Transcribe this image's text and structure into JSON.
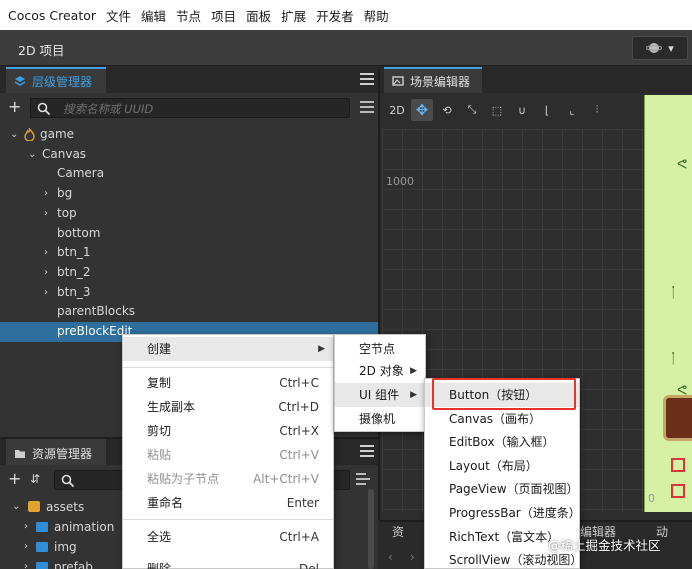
{
  "menubar": {
    "items": [
      "Cocos Creator",
      "文件",
      "编辑",
      "节点",
      "项目",
      "面板",
      "扩展",
      "开发者",
      "帮助"
    ]
  },
  "project": {
    "title": "2D 项目"
  },
  "hierarchy": {
    "tab_label": "层级管理器",
    "search_placeholder": "搜索名称或 UUID",
    "nodes": [
      "game",
      "Canvas",
      "Camera",
      "bg",
      "top",
      "bottom",
      "btn_1",
      "btn_2",
      "btn_3",
      "parentBlocks",
      "preBlockEdit"
    ],
    "selected": "preBlockEdit"
  },
  "scene": {
    "tab_label": "场景编辑器",
    "toolbar": {
      "mode_2d": "2D"
    },
    "grid_labels": {
      "top": "1000",
      "bottom": "0"
    }
  },
  "assets": {
    "tab_label": "资源管理器",
    "nodes": [
      "assets",
      "animation",
      "img",
      "prefab"
    ]
  },
  "bottom_tabs": [
    "资",
    "编辑器",
    "动"
  ],
  "context_menu": {
    "items": [
      {
        "label": "创建",
        "shortcut": "",
        "submenu": true
      },
      {
        "label": "复制",
        "shortcut": "Ctrl+C"
      },
      {
        "label": "生成副本",
        "shortcut": "Ctrl+D"
      },
      {
        "label": "剪切",
        "shortcut": "Ctrl+X"
      },
      {
        "label": "粘贴",
        "shortcut": "Ctrl+V",
        "disabled": true
      },
      {
        "label": "粘贴为子节点",
        "shortcut": "Alt+Ctrl+V",
        "disabled": true
      },
      {
        "label": "重命名",
        "shortcut": "Enter"
      },
      {
        "label": "全选",
        "shortcut": "Ctrl+A"
      },
      {
        "label": "删除",
        "shortcut": "Del"
      }
    ]
  },
  "create_submenu": {
    "items": [
      "空节点",
      "2D 对象",
      "UI 组件",
      "摄像机"
    ],
    "active": "UI 组件"
  },
  "ui_submenu": {
    "items": [
      "Button（按钮）",
      "Canvas（画布）",
      "EditBox（输入框）",
      "Layout（布局）",
      "PageView（页面视图）",
      "ProgressBar（进度条）",
      "RichText（富文本）",
      "ScrollView（滚动视图）"
    ],
    "highlighted": "Button（按钮）"
  },
  "watermark": "@稀土掘金技术社区",
  "colors": {
    "accent": "#3d9fe0",
    "selection": "#2e6f9d",
    "highlight": "#e8332a"
  }
}
